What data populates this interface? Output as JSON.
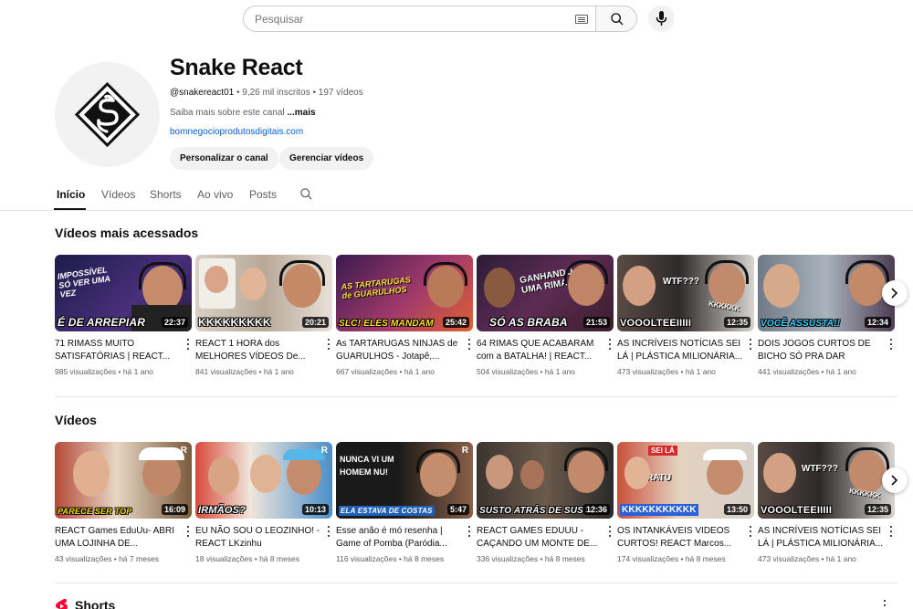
{
  "search": {
    "placeholder": "Pesquisar"
  },
  "channel": {
    "name": "Snake React",
    "handle": "@snakereact01",
    "subscribers": "9,26 mil inscritos",
    "video_count": "197 vídeos",
    "about": "Saiba mais sobre este canal",
    "about_more": "...mais",
    "link": "bomnegocioprodutosdigitais.com",
    "customize_label": "Personalizar o canal",
    "manage_label": "Gerenciar vídeos"
  },
  "tabs": [
    {
      "label": "Início"
    },
    {
      "label": "Vídeos"
    },
    {
      "label": "Shorts"
    },
    {
      "label": "Ao vivo"
    },
    {
      "label": "Posts"
    }
  ],
  "popular": {
    "title": "Vídeos mais acessados",
    "videos": [
      {
        "caption": "É DE ARREPIAR",
        "duration": "22:37",
        "title": "71 RIMASS MUITO SATISFATÓRIAS | REACT...",
        "views": "985 visualizações",
        "age": "há 1 ano"
      },
      {
        "caption": "KKKKKKKKK",
        "duration": "20:21",
        "title": "REACT 1 HORA dos MELHORES VÍDEOS De...",
        "views": "841 visualizações",
        "age": "há 1 ano"
      },
      {
        "caption": "SLC! ELES MANDAM",
        "duration": "25:42",
        "title": "As TARTARUGAS NINJAS de GUARULHOS - Jotapê,...",
        "views": "667 visualizações",
        "age": "há 1 ano"
      },
      {
        "caption": "SÓ AS BRABA",
        "duration": "21:53",
        "title": "64 RIMAS QUE ACABARAM com a BATALHA! | REACT...",
        "views": "504 visualizações",
        "age": "há 1 ano"
      },
      {
        "caption": "VOOOLTEEIIIII",
        "duration": "12:35",
        "title": "AS INCRÍVEIS NOTÍCIAS SEI LÁ | PLÁSTICA MILIONÁRIA...",
        "views": "473 visualizações",
        "age": "há 1 ano"
      },
      {
        "caption": "VOCÊ ASSUSTA!!",
        "duration": "12:34",
        "title": "DOIS JOGOS CURTOS DE BICHO SÓ PRA DAR SUSTO...",
        "views": "441 visualizações",
        "age": "há 1 ano"
      }
    ]
  },
  "videos": {
    "title": "Vídeos",
    "videos": [
      {
        "caption": "PARECE SER TOP",
        "duration": "16:09",
        "title": "REACT Games EduUu- ABRI UMA LOJINHA DE...",
        "views": "43 visualizações",
        "age": "há 7 meses"
      },
      {
        "caption": "IRMÃOS?",
        "duration": "10:13",
        "title": "EU NÃO SOU O LEOZINHO! - REACT LKzinhu",
        "views": "18 visualizações",
        "age": "há 8 meses"
      },
      {
        "caption": "ELA ESTAVA DE COSTAS",
        "duration": "5:47",
        "title": "Esse anão é mó resenha | Game of Pomba (Paródia...",
        "views": "116 visualizações",
        "age": "há 8 meses"
      },
      {
        "caption": "SUSTO ATRÁS DE SUSTO!",
        "duration": "12:36",
        "title": "REACT GAMES EDUUU - CAÇANDO UM MONTE DE...",
        "views": "336 visualizações",
        "age": "há 8 meses"
      },
      {
        "caption": "KKKKKKKKKKK",
        "duration": "13:50",
        "title": "OS INTANKÁVEIS VIDEOS CURTOS! REACT Marcos...",
        "views": "174 visualizações",
        "age": "há 8 meses"
      },
      {
        "caption": "VOOOLTEEIIIII",
        "duration": "12:35",
        "title": "AS INCRÍVEIS NOTÍCIAS SEI LÁ | PLÁSTICA MILIONÁRIA...",
        "views": "473 visualizações",
        "age": "há 1 ano"
      }
    ]
  },
  "thumb_texts": {
    "t1_top": "IMPOSSÍVEL SÓ VER UMA VEZ",
    "t3_top": "AS TARTARUGAS de GUARULHOS",
    "t4_top": "GANHANDO UMA RIMA",
    "t5_top": "WTF???",
    "t5_side": "KKKKKK",
    "t6_top": "WTF???",
    "t6_side": "KKKKKK",
    "v3_top": "NUNCA VI UM HOMEM NU!",
    "v5_top": "SEI LÁ",
    "v5_mid": "TRATU"
  },
  "shorts": {
    "title": "Shorts"
  },
  "colors": {
    "link": "#065fd4",
    "shorts_red": "#ff0033",
    "pill_bg": "#f2f2f2"
  },
  "icons": [
    "keyboard-icon",
    "search-icon",
    "mic-icon",
    "snake-logo-icon",
    "chevron-right-icon",
    "more-vert-icon",
    "shorts-icon"
  ]
}
